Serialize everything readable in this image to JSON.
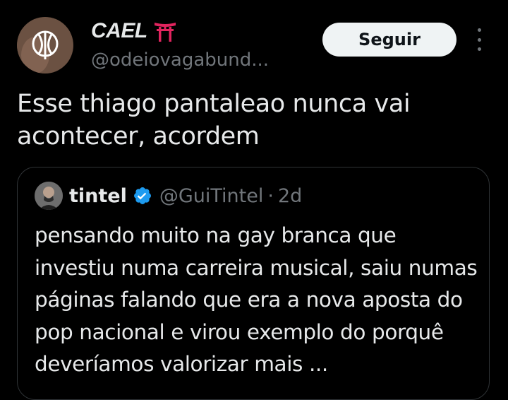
{
  "colors": {
    "background": "#000000",
    "primary_text": "#e7e9ea",
    "secondary_text": "#71767b",
    "follow_button_bg": "#eff3f4",
    "verified_badge": "#1d9bf0",
    "torii": "#e0245e",
    "card_border": "#2f3336"
  },
  "tweet": {
    "author": {
      "display_name": "CAEL",
      "name_emoji": "torii-gate-icon",
      "handle": "@odeiovagabund..."
    },
    "follow_label": "Seguir",
    "more_icon": "more-vertical-icon",
    "text": "Esse thiago pantaleao nunca vai acontecer, acordem"
  },
  "quote": {
    "author": {
      "display_name": "tintel",
      "verified_icon": "verified-badge-icon",
      "handle": "@GuiTintel",
      "separator": "·",
      "time": "2d"
    },
    "text": "pensando muito na gay branca que investiu numa carreira musical, saiu numas páginas falando que era a nova aposta do pop nacional e virou exemplo do porquê deveríamos valorizar mais ..."
  }
}
